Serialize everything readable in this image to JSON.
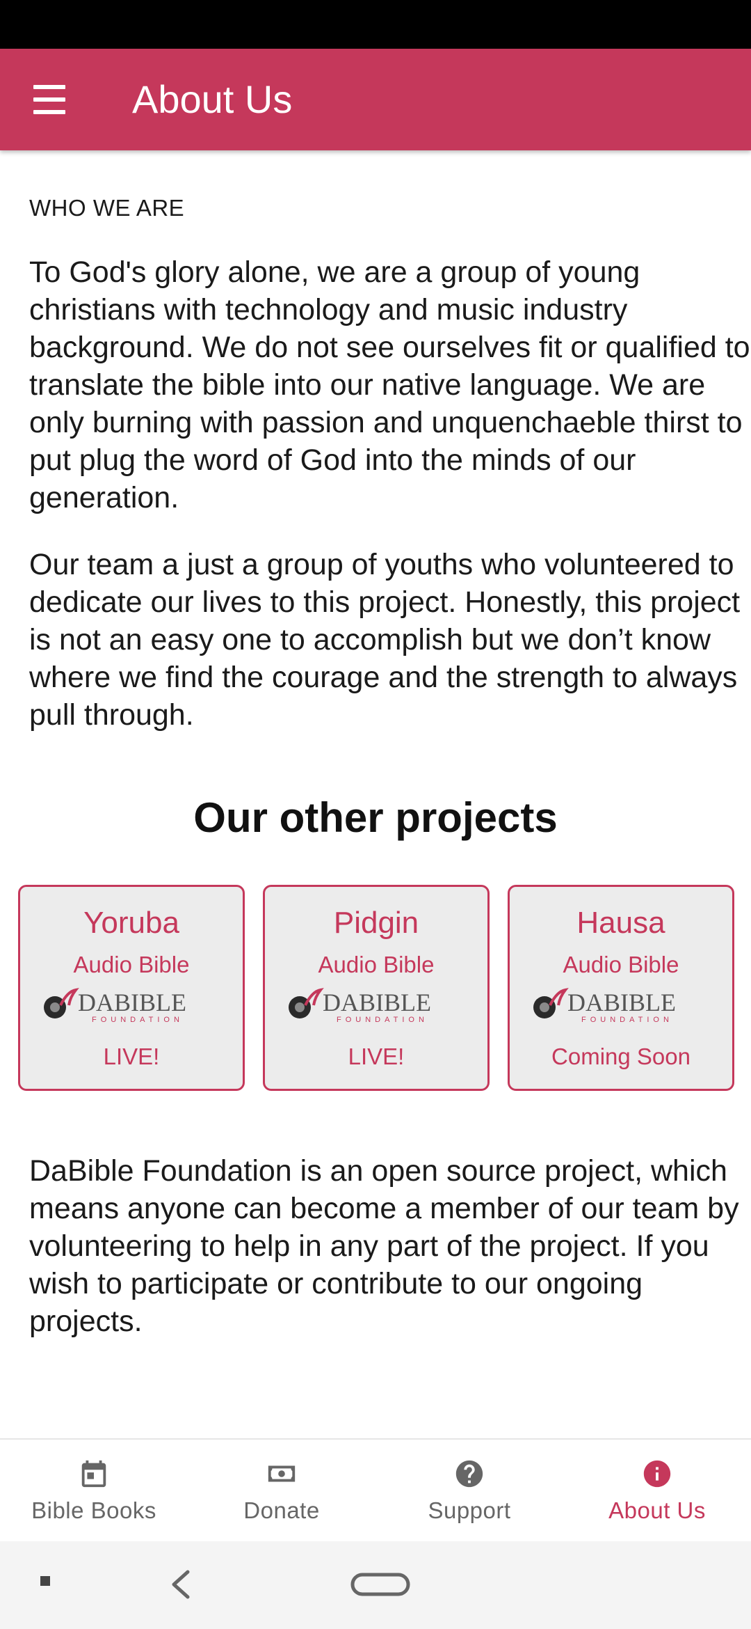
{
  "app_bar": {
    "title": "About Us",
    "menu_icon": "hamburger-menu-icon"
  },
  "who_we_are": {
    "label": "WHO WE ARE",
    "paragraph1": "To God's glory alone, we are a group of young christians with technology and music industry background. We do not see ourselves fit or qualified to translate the bible into our native language. We are only burning with passion and unquenchaeble thirst to put plug the word of God into the minds of our generation.",
    "paragraph2": "Our team a just a group of youths who volunteered to dedicate our lives to this project. Honestly, this project is not an easy one to accomplish but we don’t know where we find the courage and the strength to always pull through."
  },
  "projects": {
    "heading": "Our other projects",
    "cards": [
      {
        "language": "Yoruba",
        "subtitle": "Audio Bible",
        "status": "LIVE!",
        "logo_text": "DABIBLE",
        "logo_subtext": "FOUNDATION"
      },
      {
        "language": "Pidgin",
        "subtitle": "Audio Bible",
        "status": "LIVE!",
        "logo_text": "DABIBLE",
        "logo_subtext": "FOUNDATION"
      },
      {
        "language": "Hausa",
        "subtitle": "Audio Bible",
        "status": "Coming Soon",
        "logo_text": "DABIBLE",
        "logo_subtext": "FOUNDATION"
      }
    ]
  },
  "open_source_text": "DaBible Foundation is an open source project, which means anyone can become a member of our team by volunteering to help in any part of the project. If you wish to participate or contribute to our ongoing projects.",
  "bottom_nav": {
    "items": [
      {
        "label": "Bible Books",
        "icon": "calendar-icon",
        "active": false
      },
      {
        "label": "Donate",
        "icon": "money-icon",
        "active": false
      },
      {
        "label": "Support",
        "icon": "help-icon",
        "active": false
      },
      {
        "label": "About Us",
        "icon": "info-icon",
        "active": true
      }
    ]
  },
  "colors": {
    "accent": "#c5385b",
    "card_bg": "#ececec",
    "inactive_nav": "#666666"
  }
}
